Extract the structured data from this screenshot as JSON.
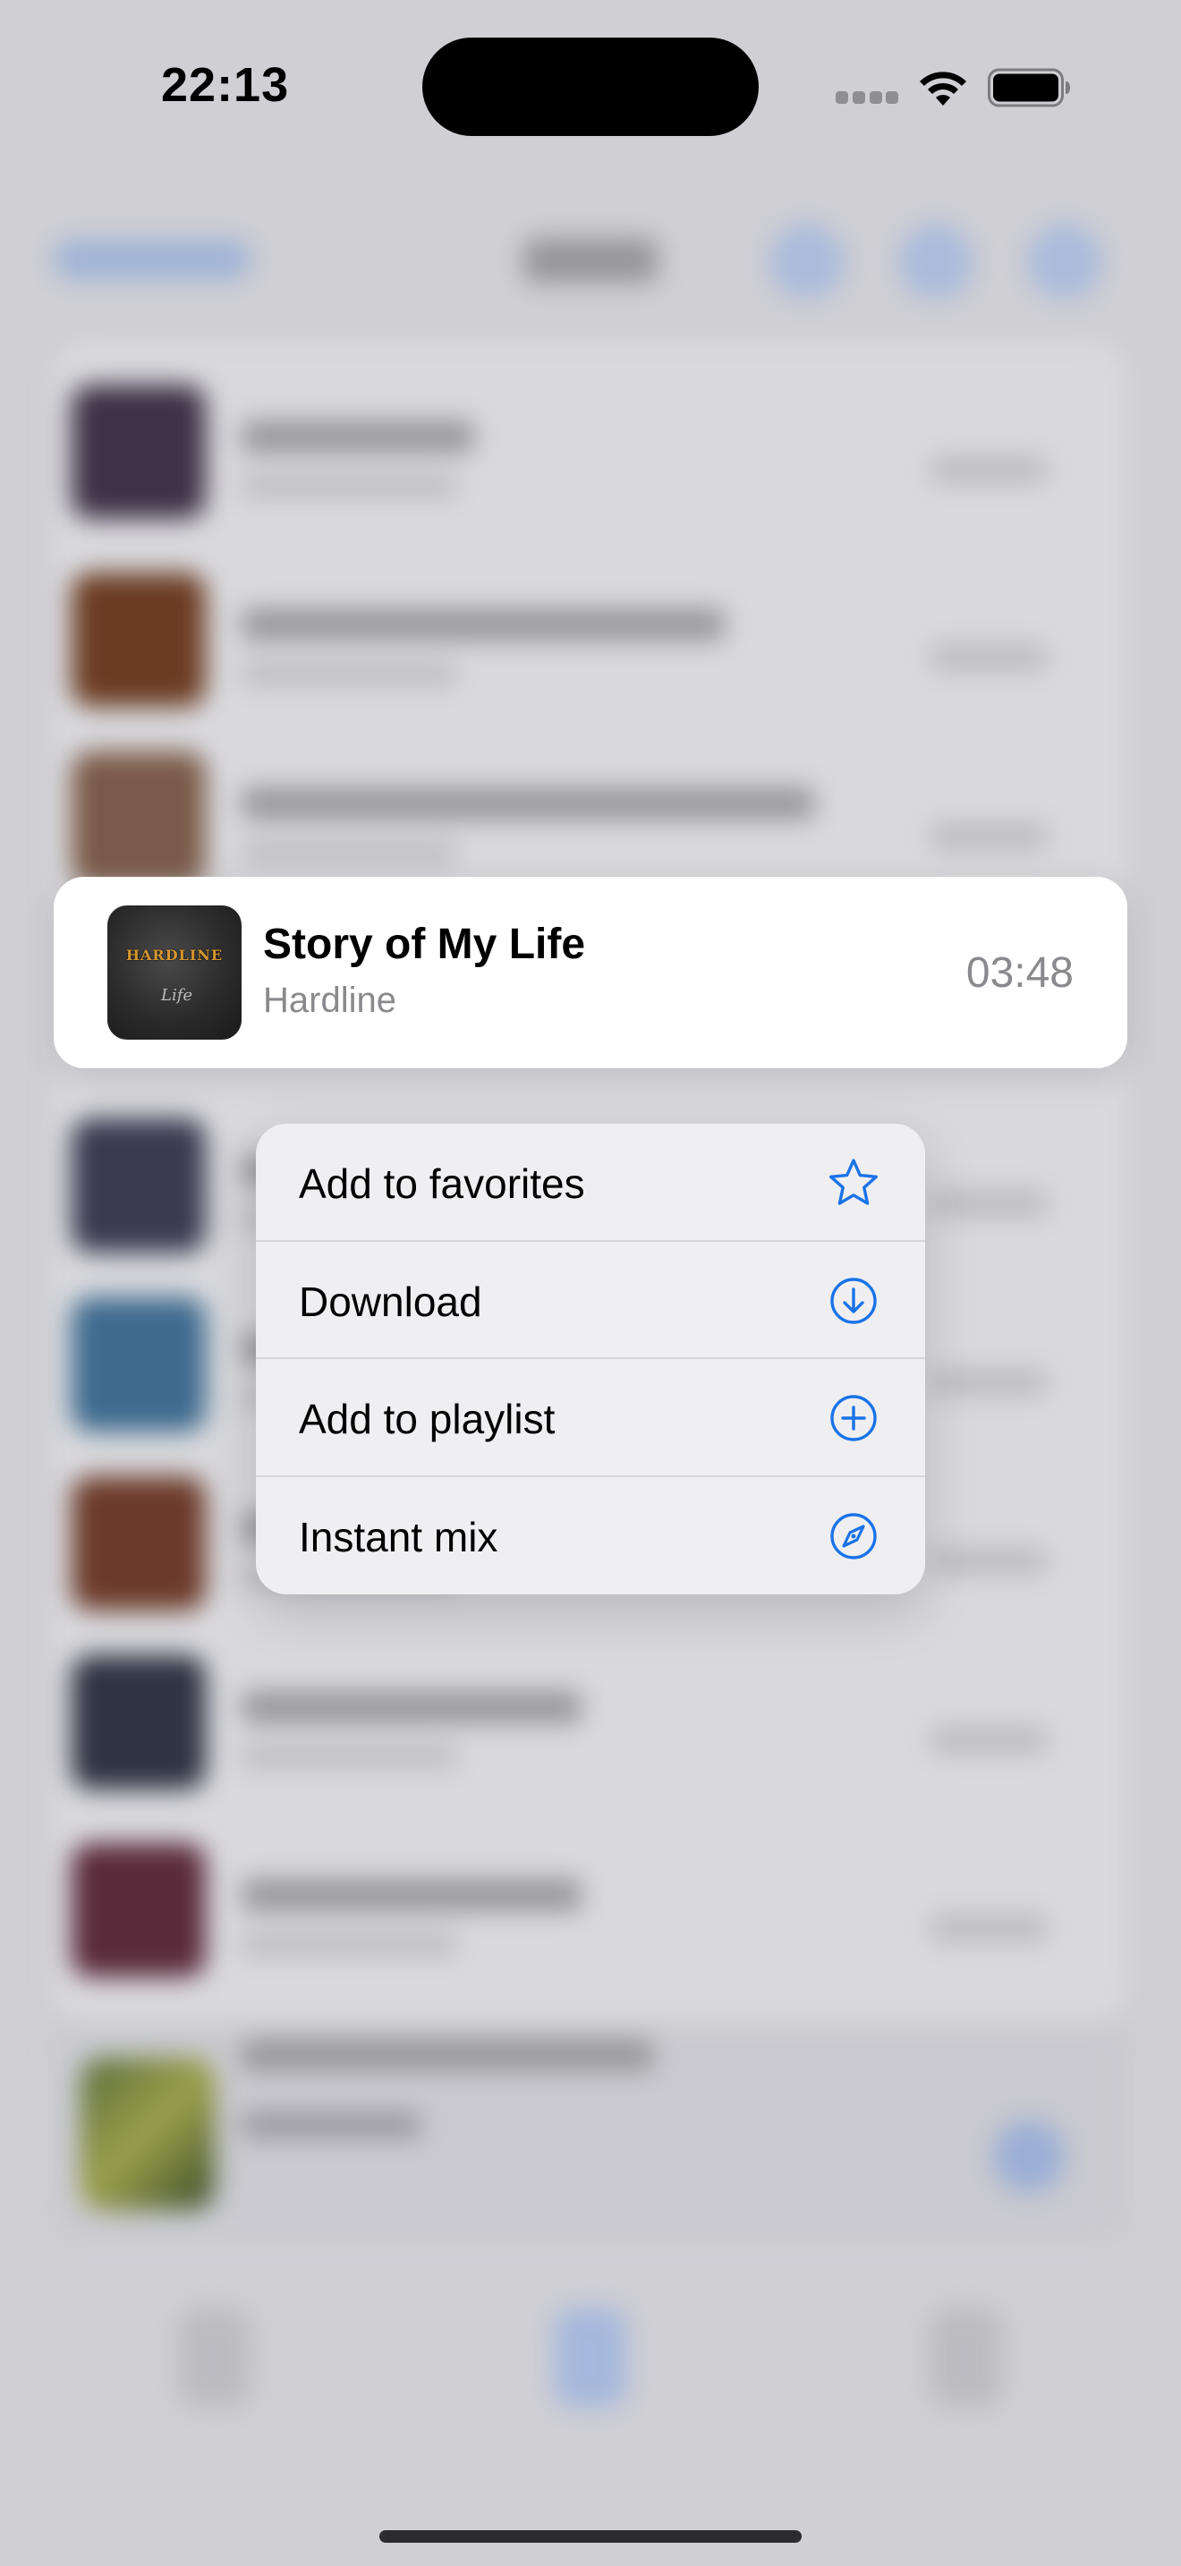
{
  "status_bar": {
    "time": "22:13"
  },
  "highlighted_song": {
    "title": "Story of My Life",
    "artist": "Hardline",
    "duration": "03:48",
    "album_art_text": "HARDLINE",
    "album_art_script": "Life"
  },
  "context_menu": {
    "items": [
      {
        "label": "Add to favorites",
        "icon": "star-icon"
      },
      {
        "label": "Download",
        "icon": "download-circle-icon"
      },
      {
        "label": "Add to playlist",
        "icon": "plus-circle-icon"
      },
      {
        "label": "Instant mix",
        "icon": "compass-icon"
      }
    ]
  },
  "colors": {
    "accent": "#1a73e8",
    "background": "#cfcfd4",
    "menu_background": "#efeff1",
    "secondary_text": "#8a8a8e"
  }
}
